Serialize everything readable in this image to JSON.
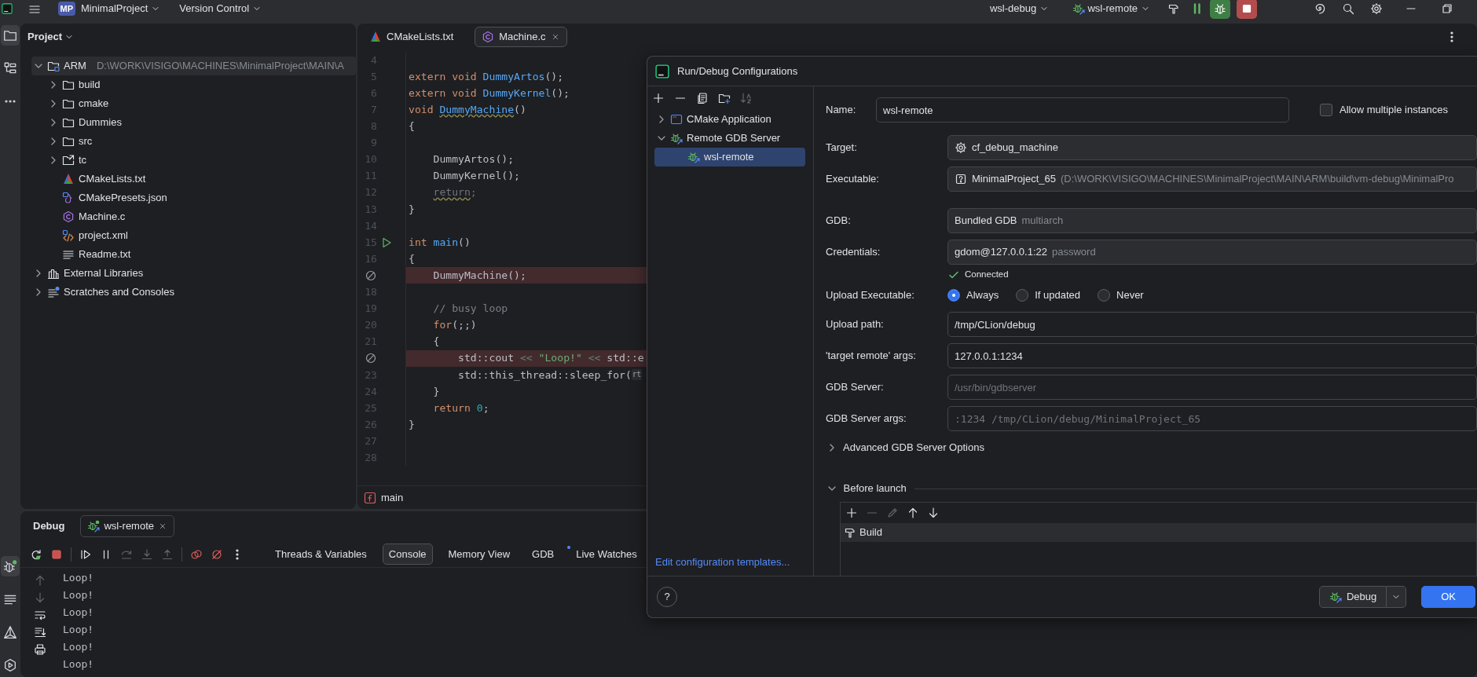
{
  "top_bar": {
    "project_badge": "MP",
    "project": "MinimalProject",
    "vcs": "Version Control",
    "build_config": "wsl-debug",
    "run_config": "wsl-remote",
    "actions": [
      {
        "kind": "build"
      },
      {
        "kind": "coverage"
      },
      {
        "kind": "debug"
      },
      {
        "kind": "stop"
      },
      {
        "kind": "ai"
      },
      {
        "kind": "search"
      },
      {
        "kind": "settings"
      },
      {
        "kind": "minimize"
      },
      {
        "kind": "restore"
      }
    ]
  },
  "strip_top": [
    {
      "kind": "project",
      "selected": true
    },
    {
      "kind": "structure",
      "selected": false
    },
    {
      "kind": "more",
      "selected": false
    }
  ],
  "strip_bottom": [
    {
      "kind": "debug",
      "selected": true
    },
    {
      "kind": "log",
      "selected": false
    },
    {
      "kind": "cmake",
      "selected": false
    },
    {
      "kind": "services",
      "selected": false
    }
  ],
  "project_panel": {
    "title": "Project",
    "tree": [
      {
        "label": "ARM",
        "path": "D:\\WORK\\VISIGO\\MACHINES\\MinimalProject\\MAIN\\A",
        "kind": "module",
        "expanded": true,
        "selected": true,
        "children": [
          {
            "label": "build",
            "kind": "folder",
            "expanded": false,
            "selected": false
          },
          {
            "label": "cmake",
            "kind": "folder",
            "expanded": false,
            "selected": false
          },
          {
            "label": "Dummies",
            "kind": "folder",
            "expanded": false,
            "selected": false
          },
          {
            "label": "src",
            "kind": "folder",
            "expanded": false,
            "selected": false
          },
          {
            "label": "tc",
            "kind": "folder-link",
            "expanded": false,
            "selected": false
          },
          {
            "label": "CMakeLists.txt",
            "kind": "cmake",
            "selected": false
          },
          {
            "label": "CMakePresets.json",
            "kind": "json",
            "selected": false
          },
          {
            "label": "Machine.c",
            "kind": "c",
            "selected": false
          },
          {
            "label": "project.xml",
            "kind": "xml",
            "selected": false
          },
          {
            "label": "Readme.txt",
            "kind": "text",
            "selected": false
          }
        ]
      },
      {
        "label": "External Libraries",
        "kind": "libraries",
        "expanded": false,
        "selected": false
      },
      {
        "label": "Scratches and Consoles",
        "kind": "scratches",
        "expanded": false,
        "selected": false
      }
    ]
  },
  "editor": {
    "tabs": [
      {
        "label": "CMakeLists.txt",
        "kind": "cmake",
        "selected": false,
        "closable": false
      },
      {
        "label": "Machine.c",
        "kind": "c",
        "selected": true,
        "closable": true
      }
    ],
    "lines": [
      {
        "number": "4",
        "highlighted": false
      },
      {
        "number": "5",
        "highlighted": false,
        "tokens": [
          {
            "text": "extern void",
            "kind": "keyword"
          },
          {
            "text": " DummyArtos",
            "kind": "function"
          },
          {
            "text": "();",
            "kind": "plain"
          }
        ]
      },
      {
        "number": "6",
        "highlighted": false,
        "tokens": [
          {
            "text": "extern void",
            "kind": "keyword"
          },
          {
            "text": " DummyKernel",
            "kind": "function"
          },
          {
            "text": "();",
            "kind": "plain"
          }
        ]
      },
      {
        "number": "7",
        "highlighted": false,
        "tokens": [
          {
            "text": "void",
            "kind": "keyword"
          },
          {
            "text": " DummyMachine",
            "kind": "function_warning"
          },
          {
            "text": "()",
            "kind": "plain"
          }
        ]
      },
      {
        "number": "8",
        "highlighted": false,
        "tokens": [
          {
            "text": "{",
            "kind": "plain"
          }
        ]
      },
      {
        "number": "9",
        "highlighted": false
      },
      {
        "number": "10",
        "highlighted": false,
        "tokens": [
          {
            "text": "    DummyArtos();",
            "kind": "plain"
          }
        ]
      },
      {
        "number": "11",
        "highlighted": false,
        "tokens": [
          {
            "text": "    DummyKernel();",
            "kind": "plain"
          }
        ]
      },
      {
        "number": "12",
        "highlighted": false,
        "tokens": [
          {
            "text": "    return",
            "kind": "unreachable_warning"
          },
          {
            "text": ";",
            "kind": "unreachable"
          }
        ]
      },
      {
        "number": "13",
        "highlighted": false,
        "tokens": [
          {
            "text": "}",
            "kind": "plain"
          }
        ]
      },
      {
        "number": "14",
        "highlighted": false
      },
      {
        "number": "15",
        "kind": "run",
        "highlighted": false,
        "tokens": [
          {
            "text": "int",
            "kind": "keyword"
          },
          {
            "text": " main",
            "kind": "function"
          },
          {
            "text": "()",
            "kind": "plain"
          }
        ]
      },
      {
        "number": "16",
        "highlighted": false,
        "tokens": [
          {
            "text": "{",
            "kind": "plain"
          }
        ]
      },
      {
        "kind": "breakpoint",
        "highlighted": true,
        "tokens": [
          {
            "text": "    DummyMachine();",
            "kind": "plain"
          }
        ]
      },
      {
        "number": "18",
        "highlighted": false
      },
      {
        "number": "19",
        "highlighted": false,
        "tokens": [
          {
            "text": "    // busy loop",
            "kind": "comment"
          }
        ]
      },
      {
        "number": "20",
        "highlighted": false,
        "tokens": [
          {
            "text": "    for",
            "kind": "keyword"
          },
          {
            "text": "(;;)",
            "kind": "plain"
          }
        ]
      },
      {
        "number": "21",
        "highlighted": false,
        "tokens": [
          {
            "text": "    {",
            "kind": "plain"
          }
        ]
      },
      {
        "kind": "breakpoint",
        "highlighted": true,
        "tokens": [
          {
            "text": "        std::cout",
            "kind": "plain"
          },
          {
            "text": " <<",
            "kind": "operator"
          },
          {
            "text": " \"Loop!\"",
            "kind": "string"
          },
          {
            "text": " <<",
            "kind": "operator"
          },
          {
            "text": " std::e",
            "kind": "plain"
          }
        ]
      },
      {
        "number": "23",
        "highlighted": false,
        "tokens": [
          {
            "text": "        std::this_thread::sleep_for(",
            "kind": "plain"
          }
        ],
        "inlay_hint": "rt"
      },
      {
        "number": "24",
        "highlighted": false,
        "tokens": [
          {
            "text": "    }",
            "kind": "plain"
          }
        ]
      },
      {
        "number": "25",
        "highlighted": false,
        "tokens": [
          {
            "text": "    return",
            "kind": "keyword"
          },
          {
            "text": " 0",
            "kind": "number"
          },
          {
            "text": ";",
            "kind": "plain"
          }
        ]
      },
      {
        "number": "26",
        "highlighted": false,
        "tokens": [
          {
            "text": "}",
            "kind": "plain"
          }
        ]
      },
      {
        "number": "27",
        "highlighted": false
      },
      {
        "number": "28",
        "highlighted": false
      }
    ],
    "breadcrumb": "main"
  },
  "debug_panel": {
    "title": "Debug",
    "session_tab": "wsl-remote",
    "toolbar": [
      {
        "kind": "rerun",
        "disabled": false
      },
      {
        "kind": "stop",
        "disabled": false
      },
      {
        "kind": "separator"
      },
      {
        "kind": "resume",
        "disabled": false
      },
      {
        "kind": "pause",
        "disabled": false
      },
      {
        "kind": "step-over",
        "disabled": true
      },
      {
        "kind": "step-into",
        "disabled": true
      },
      {
        "kind": "step-out",
        "disabled": true
      },
      {
        "kind": "separator"
      },
      {
        "kind": "view-breakpoints",
        "disabled": false
      },
      {
        "kind": "mute-breakpoints",
        "disabled": false
      },
      {
        "kind": "more",
        "disabled": false
      }
    ],
    "view_tabs": [
      {
        "label": "Threads & Variables",
        "selected": false,
        "dot": false
      },
      {
        "label": "Console",
        "selected": true,
        "dot": false
      },
      {
        "label": "Memory View",
        "selected": false,
        "dot": false
      },
      {
        "label": "GDB",
        "selected": false,
        "dot": false
      },
      {
        "label": "Live Watches",
        "selected": false,
        "dot": true
      }
    ],
    "console_tools": [
      {
        "kind": "up",
        "disabled": true
      },
      {
        "kind": "down",
        "disabled": true
      },
      {
        "kind": "wrap",
        "disabled": false
      },
      {
        "kind": "scroll-end",
        "disabled": false
      },
      {
        "kind": "print",
        "disabled": false
      }
    ],
    "console_lines": [
      "Loop!",
      "Loop!",
      "Loop!",
      "Loop!",
      "Loop!",
      "Loop!"
    ]
  },
  "dialog": {
    "title": "Run/Debug Configurations",
    "toolbar": [
      {
        "kind": "add",
        "disabled": false
      },
      {
        "kind": "remove",
        "disabled": false
      },
      {
        "kind": "copy",
        "disabled": false
      },
      {
        "kind": "folder-add",
        "disabled": false
      },
      {
        "kind": "sort",
        "disabled": true
      }
    ],
    "tree": [
      {
        "label": "CMake Application",
        "kind": "cmake-app",
        "expanded": false,
        "selected": false
      },
      {
        "label": "Remote GDB Server",
        "kind": "remote-gdb",
        "expanded": true,
        "selected": false,
        "children": [
          {
            "label": "wsl-remote",
            "kind": "remote-gdb",
            "selected": true
          }
        ]
      }
    ],
    "templates_link": "Edit configuration templates...",
    "name_label": "Name:",
    "name_value": "wsl-remote",
    "allow_multiple": {
      "label": "Allow multiple instances",
      "checked": false
    },
    "field_groups": [
      [
        {
          "kind": "target_select",
          "label": "Target:",
          "value": "cf_debug_machine"
        },
        {
          "kind": "file_select",
          "label": "Executable:",
          "value": "MinimalProject_65",
          "detail": "(D:\\WORK\\VISIGO\\MACHINES\\MinimalProject\\MAIN\\ARM\\build\\vm-debug\\MinimalPro"
        }
      ],
      [
        {
          "kind": "select",
          "label": "GDB:",
          "value": "Bundled GDB",
          "detail": "multiarch"
        },
        {
          "kind": "select",
          "label": "Credentials:",
          "value": "gdom@127.0.0.1:22",
          "detail": "password"
        },
        {
          "kind": "status",
          "value": "Connected"
        },
        {
          "kind": "radio",
          "label": "Upload Executable:",
          "options": [
            {
              "label": "Always",
              "selected": true
            },
            {
              "label": "If updated",
              "selected": false
            },
            {
              "label": "Never",
              "selected": false
            }
          ]
        },
        {
          "kind": "input",
          "label": "Upload path:",
          "value": "/tmp/CLion/debug"
        },
        {
          "kind": "input",
          "label": "'target remote' args:",
          "value": "127.0.0.1:1234"
        },
        {
          "kind": "input_hint",
          "label": "GDB Server:",
          "placeholder": "/usr/bin/gdbserver"
        },
        {
          "kind": "input_hint_code",
          "label": "GDB Server args:",
          "placeholder": ":1234 /tmp/CLion/debug/MinimalProject_65"
        }
      ]
    ],
    "advanced": {
      "label": "Advanced GDB Server Options",
      "expanded": false
    },
    "before_launch": {
      "label": "Before launch",
      "expanded": true,
      "toolbar": [
        {
          "kind": "add",
          "disabled": false
        },
        {
          "kind": "remove",
          "disabled": true
        },
        {
          "kind": "edit",
          "disabled": true
        },
        {
          "kind": "up",
          "disabled": false
        },
        {
          "kind": "down",
          "disabled": false
        }
      ],
      "items": [
        {
          "label": "Build",
          "kind": "build",
          "selected": true
        }
      ]
    },
    "help_button": "?",
    "buttons": [
      {
        "label": "Debug",
        "kind": "split"
      },
      {
        "label": "OK",
        "kind": "primary"
      }
    ]
  }
}
